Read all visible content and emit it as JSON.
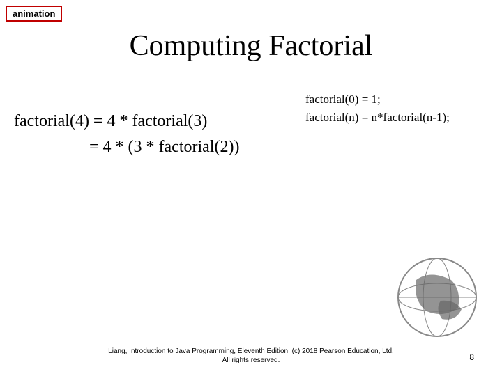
{
  "badge": "animation",
  "title": "Computing Factorial",
  "calc": {
    "line1": "factorial(4) = 4 * factorial(3)",
    "line2": "                  = 4 * (3 * factorial(2))"
  },
  "basecase": {
    "line1": "factorial(0) = 1;",
    "line2": "factorial(n) = n*factorial(n-1);"
  },
  "footer_line1": "Liang, Introduction to Java Programming, Eleventh Edition, (c) 2018 Pearson Education, Ltd.",
  "footer_line2": "All rights reserved.",
  "page_number": "8"
}
